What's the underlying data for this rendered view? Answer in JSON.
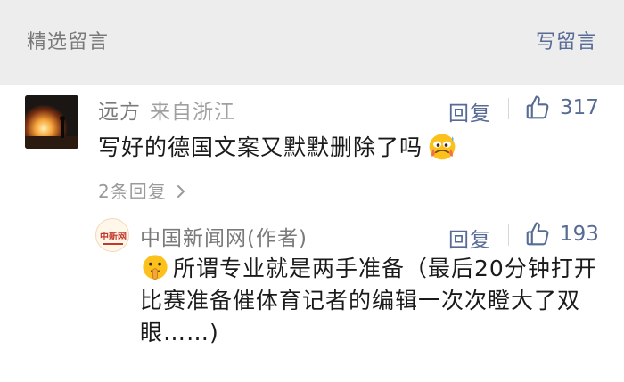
{
  "header": {
    "title": "精选留言",
    "write_label": "写留言"
  },
  "comment": {
    "author": "远方",
    "location": "来自浙江",
    "text": "写好的德国文案又默默删除了吗",
    "emoji": "sweating-face-emoji",
    "reply_label": "回复",
    "likes": "317",
    "replies_toggle": "2条回复"
  },
  "reply": {
    "author": "中国新闻网(作者)",
    "avatar_text": "中新网",
    "text": "所谓专业就是两手准备（最后20分钟打开比赛准备催体育记者的编辑一次次瞪大了双眼……)",
    "emoji": "shushing-face-emoji",
    "reply_label": "回复",
    "likes": "193"
  },
  "colors": {
    "link": "#576b95",
    "muted": "#7a7a7a",
    "header_bg": "#ededed"
  }
}
